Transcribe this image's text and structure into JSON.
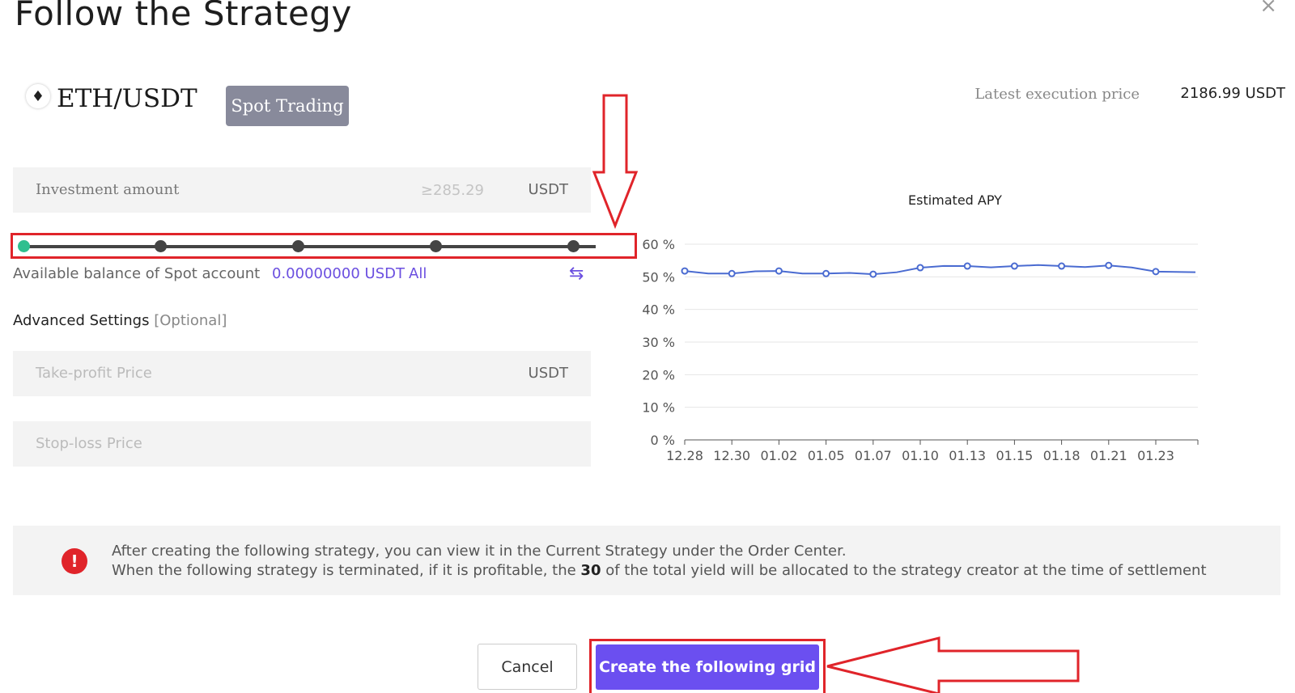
{
  "dialog": {
    "title": "Follow the Strategy",
    "close_glyph": "×"
  },
  "pair": {
    "icon": "eth-icon",
    "icon_glyph": "♦",
    "name": "ETH/USDT",
    "tag": "Spot Trading"
  },
  "latest": {
    "label": "Latest execution price",
    "value": "2186.99 USDT"
  },
  "investment": {
    "label": "Investment amount",
    "min": "≥285.29",
    "unit": "USDT"
  },
  "slider": {
    "value_percent": 0,
    "stops": 5
  },
  "balance": {
    "label": "Available balance of Spot account",
    "value": "0.00000000 USDT",
    "all_label": "All",
    "swap_icon": "swap-icon",
    "swap_glyph": "⇆"
  },
  "advanced": {
    "label": "Advanced Settings",
    "optional": "[Optional]"
  },
  "take_profit": {
    "placeholder": "Take-profit Price",
    "unit": "USDT"
  },
  "stop_loss": {
    "placeholder": "Stop-loss Price"
  },
  "chart_data": {
    "type": "line",
    "title": "Estimated APY",
    "xlabel": "",
    "ylabel": "",
    "y_ticks": [
      "60 %",
      "50 %",
      "40 %",
      "30 %",
      "20 %",
      "10 %",
      "0 %"
    ],
    "ylim": [
      0,
      60
    ],
    "grid": true,
    "categories": [
      "12.28",
      "12.30",
      "01.02",
      "01.05",
      "01.07",
      "01.10",
      "01.13",
      "01.15",
      "01.18",
      "01.21",
      "01.23"
    ],
    "series": [
      {
        "values": [
          51.8,
          51.0,
          51.8,
          51.0,
          50.8,
          52.8,
          53.3,
          53.3,
          53.3,
          53.5,
          51.6
        ]
      }
    ],
    "color": "#4a6bd1"
  },
  "notice": {
    "icon": "alert-icon",
    "icon_glyph": "!",
    "line1": "After creating the following strategy, you can view it in the Current Strategy under the Order Center.",
    "line2_before": "When the following strategy is terminated, if it is profitable, the ",
    "line2_bold": "30",
    "line2_after": " of the total yield will be allocated to the strategy creator at the time of settlement"
  },
  "buttons": {
    "cancel": "Cancel",
    "create": "Create the following grid"
  },
  "colors": {
    "accent": "#6b4ff0",
    "annotation": "#e0242a",
    "slider_start": "#2fbf8f"
  }
}
